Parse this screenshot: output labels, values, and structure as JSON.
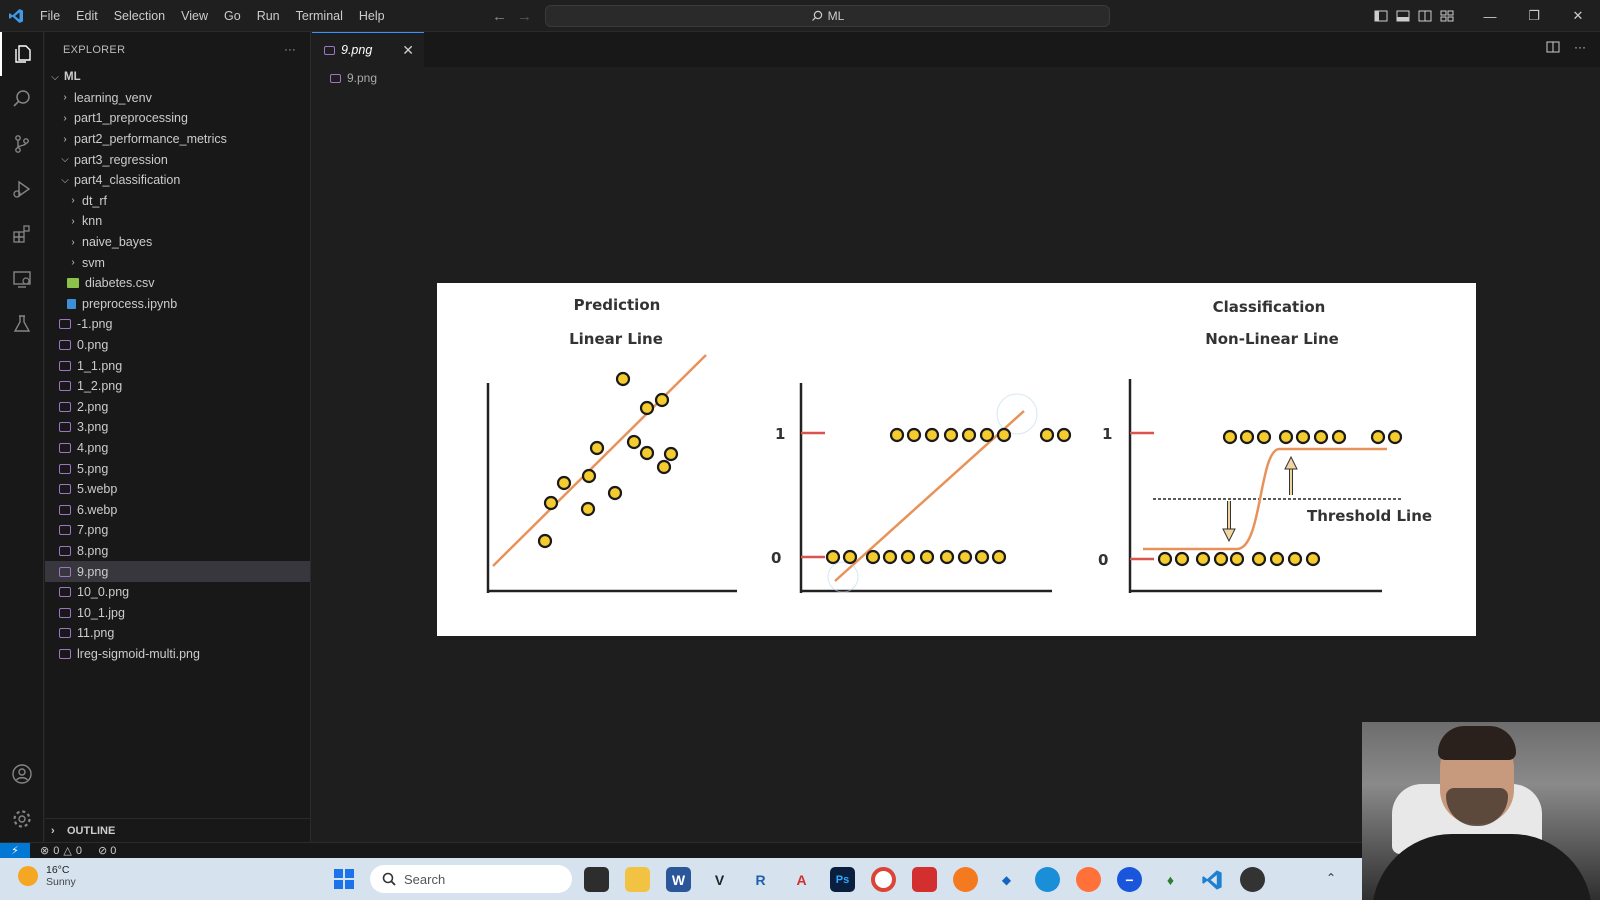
{
  "titlebar": {
    "menu": [
      "File",
      "Edit",
      "Selection",
      "View",
      "Go",
      "Run",
      "Terminal",
      "Help"
    ],
    "search_text": "ML"
  },
  "sidebar": {
    "title": "EXPLORER",
    "more": "···",
    "root": "ML",
    "items": [
      {
        "label": "learning_venv",
        "type": "folder",
        "depth": 1,
        "open": false
      },
      {
        "label": "part1_preprocessing",
        "type": "folder",
        "depth": 1,
        "open": false
      },
      {
        "label": "part2_performance_metrics",
        "type": "folder",
        "depth": 1,
        "open": false
      },
      {
        "label": "part3_regression",
        "type": "folder",
        "depth": 1,
        "open": true
      },
      {
        "label": "part4_classification",
        "type": "folder",
        "depth": 1,
        "open": true
      },
      {
        "label": "dt_rf",
        "type": "folder",
        "depth": 2,
        "open": false
      },
      {
        "label": "knn",
        "type": "folder",
        "depth": 2,
        "open": false
      },
      {
        "label": "naive_bayes",
        "type": "folder",
        "depth": 2,
        "open": false
      },
      {
        "label": "svm",
        "type": "folder",
        "depth": 2,
        "open": false
      },
      {
        "label": "diabetes.csv",
        "type": "csv",
        "depth": 2
      },
      {
        "label": "preprocess.ipynb",
        "type": "notebook",
        "depth": 2
      },
      {
        "label": "-1.png",
        "type": "image",
        "depth": 1
      },
      {
        "label": "0.png",
        "type": "image",
        "depth": 1
      },
      {
        "label": "1_1.png",
        "type": "image",
        "depth": 1
      },
      {
        "label": "1_2.png",
        "type": "image",
        "depth": 1
      },
      {
        "label": "2.png",
        "type": "image",
        "depth": 1
      },
      {
        "label": "3.png",
        "type": "image",
        "depth": 1
      },
      {
        "label": "4.png",
        "type": "image",
        "depth": 1
      },
      {
        "label": "5.png",
        "type": "image",
        "depth": 1
      },
      {
        "label": "5.webp",
        "type": "image",
        "depth": 1
      },
      {
        "label": "6.webp",
        "type": "image",
        "depth": 1
      },
      {
        "label": "7.png",
        "type": "image",
        "depth": 1
      },
      {
        "label": "8.png",
        "type": "image",
        "depth": 1
      },
      {
        "label": "9.png",
        "type": "image",
        "depth": 1,
        "selected": true
      },
      {
        "label": "10_0.png",
        "type": "image",
        "depth": 1
      },
      {
        "label": "10_1.jpg",
        "type": "image",
        "depth": 1
      },
      {
        "label": "11.png",
        "type": "image",
        "depth": 1
      },
      {
        "label": "lreg-sigmoid-multi.png",
        "type": "image",
        "depth": 1
      }
    ],
    "outline": "OUTLINE"
  },
  "editor": {
    "tab_label": "9.png",
    "breadcrumb": "9.png"
  },
  "figure": {
    "left_title": "Prediction",
    "left_subtitle": "Linear Line",
    "right_title": "Classification",
    "right_subtitle": "Non-Linear Line",
    "threshold_label": "Threshold Line",
    "tick_one": "1",
    "tick_zero": "0"
  },
  "statusbar": {
    "errors": "0",
    "warnings": "0",
    "ports": "0"
  },
  "taskbar": {
    "temperature": "16°C",
    "condition": "Sunny",
    "search_placeholder": "Search"
  },
  "colors": {
    "accent": "#3794ff",
    "line_orange": "#e8925a",
    "dot_fill": "#f5cc2f",
    "tick_red": "#d9534f"
  }
}
